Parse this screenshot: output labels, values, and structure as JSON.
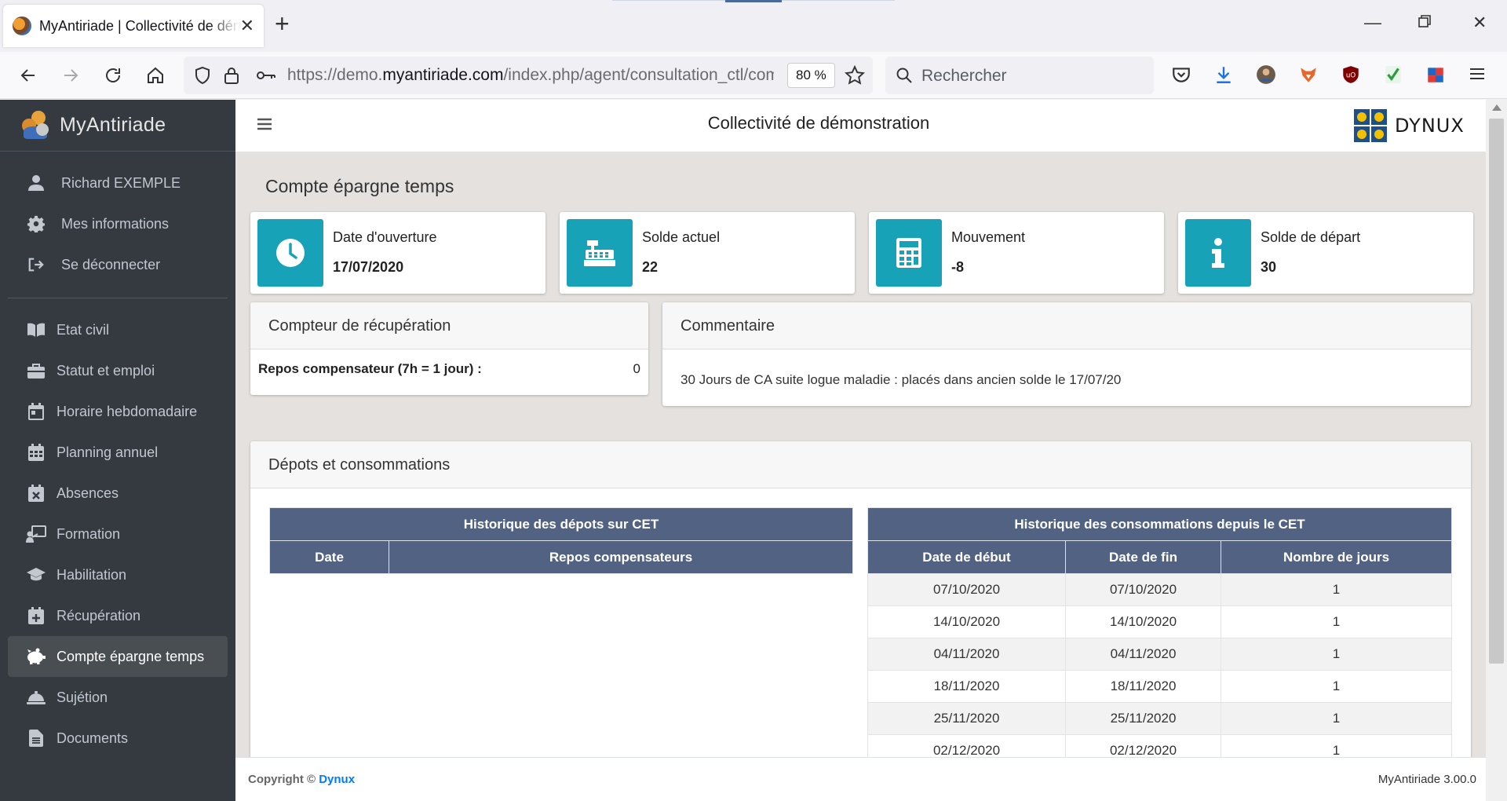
{
  "browser": {
    "tab_title": "MyAntiriade | Collectivité de démonstration",
    "url_prefix": "https://demo.",
    "url_domain": "myantiriade.com",
    "url_suffix": "/index.php/agent/consultation_ctl/com",
    "zoom": "80 %",
    "search_placeholder": "Rechercher"
  },
  "sidebar": {
    "brand": "MyAntiriade",
    "user": [
      {
        "label": "Richard EXEMPLE",
        "icon": "user-icon"
      },
      {
        "label": "Mes informations",
        "icon": "gear-icon"
      },
      {
        "label": "Se déconnecter",
        "icon": "logout-icon"
      }
    ],
    "menu": [
      {
        "label": "Etat civil",
        "icon": "book-icon"
      },
      {
        "label": "Statut et emploi",
        "icon": "briefcase-icon"
      },
      {
        "label": "Horaire hebdomadaire",
        "icon": "calendar-day-icon"
      },
      {
        "label": "Planning annuel",
        "icon": "calendar-grid-icon"
      },
      {
        "label": "Absences",
        "icon": "calendar-x-icon"
      },
      {
        "label": "Formation",
        "icon": "chalkboard-teacher-icon"
      },
      {
        "label": "Habilitation",
        "icon": "graduation-cap-icon"
      },
      {
        "label": "Récupération",
        "icon": "calendar-plus-icon"
      },
      {
        "label": "Compte épargne temps",
        "icon": "piggy-bank-icon",
        "active": true
      },
      {
        "label": "Sujétion",
        "icon": "service-bell-icon"
      },
      {
        "label": "Documents",
        "icon": "document-icon"
      }
    ]
  },
  "header": {
    "title": "Collectivité de démonstration",
    "logo_text": "DYNUX"
  },
  "page": {
    "title": "Compte épargne temps",
    "info_boxes": [
      {
        "label": "Date d'ouverture",
        "value": "17/07/2020",
        "icon": "clock-icon"
      },
      {
        "label": "Solde actuel",
        "value": "22",
        "icon": "cash-register-icon"
      },
      {
        "label": "Mouvement",
        "value": "-8",
        "icon": "calculator-icon"
      },
      {
        "label": "Solde de départ",
        "value": "30",
        "icon": "info-icon"
      }
    ],
    "recup": {
      "title": "Compteur de récupération",
      "label": "Repos compensateur (7h = 1 jour) :",
      "value": "0"
    },
    "comment": {
      "title": "Commentaire",
      "text": "30 Jours de CA suite logue maladie : placés dans ancien solde le 17/07/20"
    },
    "deposits": {
      "title": "Dépots et consommations",
      "left_table": {
        "title": "Historique des dépots sur CET",
        "columns": [
          "Date",
          "Repos compensateurs"
        ],
        "rows": []
      },
      "right_table": {
        "title": "Historique des consommations depuis le CET",
        "columns": [
          "Date de début",
          "Date de fin",
          "Nombre de jours"
        ],
        "rows": [
          [
            "07/10/2020",
            "07/10/2020",
            "1"
          ],
          [
            "14/10/2020",
            "14/10/2020",
            "1"
          ],
          [
            "04/11/2020",
            "04/11/2020",
            "1"
          ],
          [
            "18/11/2020",
            "18/11/2020",
            "1"
          ],
          [
            "25/11/2020",
            "25/11/2020",
            "1"
          ],
          [
            "02/12/2020",
            "02/12/2020",
            "1"
          ]
        ]
      }
    }
  },
  "footer": {
    "copyright_prefix": "Copyright ©",
    "copyright_link": "Dynux",
    "version": "MyAntiriade 3.00.0"
  },
  "colors": {
    "sidebar_bg": "#343a40",
    "accent": "#17a2b8",
    "table_header": "#526283",
    "link": "#007bff"
  }
}
